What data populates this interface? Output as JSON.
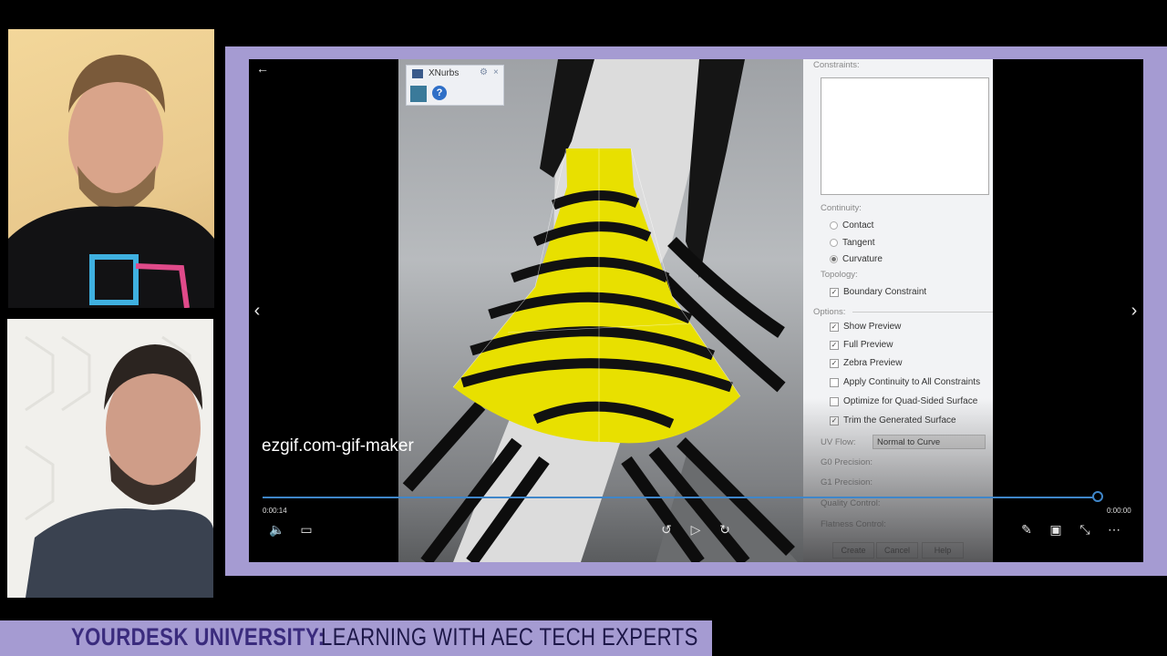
{
  "lower_third": {
    "part1": "YOURDESK UNIVERSITY:",
    "part2": "LEARNING WITH AEC TECH EXPERTS"
  },
  "player": {
    "title": "ezgif.com-gif-maker",
    "time_current": "0:00:14",
    "time_total": "0:00:00",
    "progress": 0.99
  },
  "xnurbs": {
    "title": "XNurbs"
  },
  "panel": {
    "constraints_label": "Constraints:",
    "continuity_label": "Continuity:",
    "continuity_options": [
      "Contact",
      "Tangent",
      "Curvature"
    ],
    "continuity_selected": "Curvature",
    "topology_label": "Topology:",
    "boundary_constraint": "Boundary Constraint",
    "options_label": "Options:",
    "options": [
      {
        "label": "Show Preview",
        "checked": true
      },
      {
        "label": "Full Preview",
        "checked": true
      },
      {
        "label": "Zebra Preview",
        "checked": true
      },
      {
        "label": "Apply Continuity to All Constraints",
        "checked": false
      },
      {
        "label": "Optimize for Quad-Sided Surface",
        "checked": false
      },
      {
        "label": "Trim the Generated Surface",
        "checked": true
      }
    ],
    "uv_flow_label": "UV Flow:",
    "uv_flow_value": "Normal to Curve",
    "g0_label": "G0 Precision:",
    "g1_label": "G1 Precision:",
    "quality_label": "Quality Control:",
    "flatness_label": "Flatness Control:",
    "buttons": [
      "Create",
      "Cancel",
      "Help"
    ]
  },
  "colors": {
    "accent": "#a59bd2",
    "progress": "#3f86c9",
    "surface": "#e8e000"
  }
}
